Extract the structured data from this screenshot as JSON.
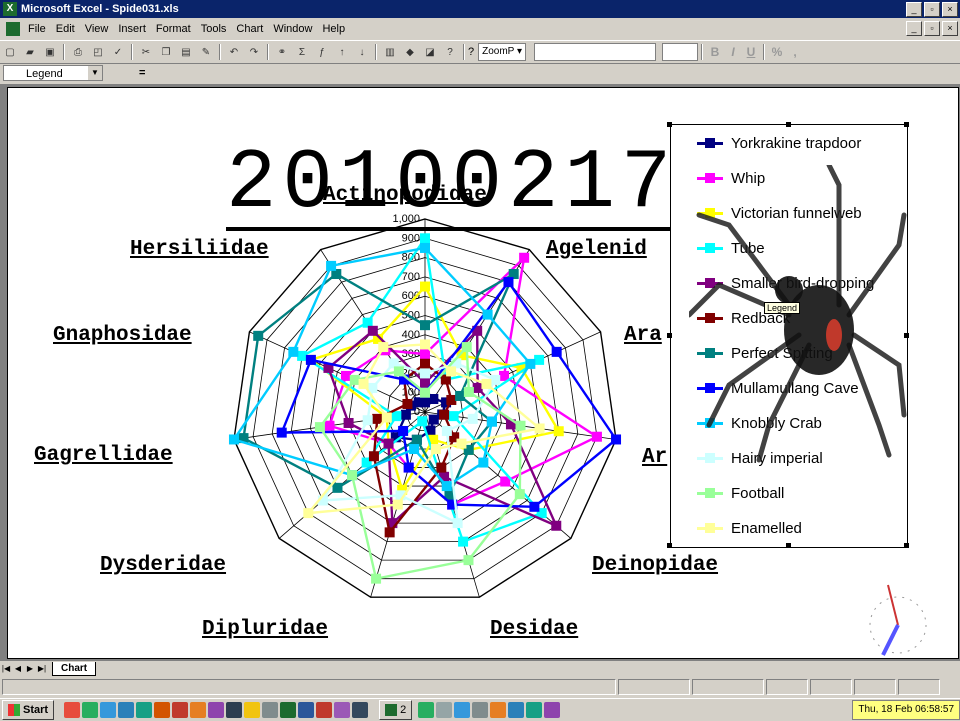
{
  "window": {
    "title": "Microsoft Excel - Spide031.xls",
    "min": "_",
    "max": "▫",
    "close": "×"
  },
  "menu": [
    "File",
    "Edit",
    "View",
    "Insert",
    "Format",
    "Tools",
    "Chart",
    "Window",
    "Help"
  ],
  "toolbar": {
    "zoom": "ZoomP",
    "help_q": "?"
  },
  "formula_bar": {
    "name_box": "Legend",
    "eq": "="
  },
  "chart_data": {
    "type": "radar",
    "title": "20100217",
    "categories": [
      "Actinopodidae",
      "Agelenidae",
      "Araneidae",
      "Archaeidae",
      "Deinopidae",
      "Desidae",
      "Dipluridae",
      "Dysderidae",
      "Gagrellidae",
      "Gnaphosidae",
      "Hersiliidae"
    ],
    "categories_shown": [
      "Actinopodidae",
      "Agelenid",
      "Ara",
      "Ar",
      "Deinopidae",
      "Desidae",
      "Dipluridae",
      "Dysderidae",
      "Gagrellidae",
      "Gnaphosidae",
      "Hersiliidae"
    ],
    "rmax": 1000,
    "axis_ticks": [
      "1,000",
      "900",
      "800",
      "700",
      "600",
      "500",
      "400",
      "300",
      "200",
      "100",
      "0"
    ],
    "series": [
      {
        "name": "Yorkrakine trapdoor",
        "color": "#000080",
        "values": [
          50,
          80,
          120,
          90,
          60,
          100,
          150,
          200,
          100,
          80,
          60
        ]
      },
      {
        "name": "Whip",
        "color": "#ff00ff",
        "values": [
          300,
          950,
          450,
          900,
          550,
          500,
          300,
          250,
          500,
          450,
          380
        ]
      },
      {
        "name": "Victorian funnelweb",
        "color": "#ffff00",
        "values": [
          650,
          350,
          550,
          700,
          300,
          150,
          420,
          250,
          200,
          650,
          450
        ]
      },
      {
        "name": "Tube",
        "color": "#00ffff",
        "values": [
          900,
          200,
          650,
          150,
          800,
          700,
          50,
          400,
          150,
          700,
          550
        ]
      },
      {
        "name": "Smaller bird-dropping",
        "color": "#800080",
        "values": [
          150,
          500,
          300,
          450,
          900,
          350,
          600,
          250,
          400,
          550,
          500
        ]
      },
      {
        "name": "Redback",
        "color": "#800000",
        "values": [
          250,
          200,
          150,
          100,
          200,
          300,
          650,
          350,
          250,
          100,
          200
        ]
      },
      {
        "name": "Perfect Spitting",
        "color": "#008080",
        "values": [
          450,
          850,
          200,
          350,
          300,
          450,
          150,
          600,
          950,
          950,
          850
        ]
      },
      {
        "name": "Mullamullang Cave",
        "color": "#0000ff",
        "values": [
          100,
          800,
          750,
          1000,
          750,
          500,
          300,
          150,
          750,
          650,
          200
        ]
      },
      {
        "name": "Knobbly Crab",
        "color": "#00ccff",
        "values": [
          850,
          600,
          600,
          350,
          400,
          400,
          200,
          500,
          1000,
          750,
          900
        ]
      },
      {
        "name": "Hairy imperial",
        "color": "#ccffff",
        "values": [
          200,
          300,
          400,
          250,
          150,
          600,
          450,
          700,
          300,
          300,
          300
        ]
      },
      {
        "name": "Football",
        "color": "#99ff99",
        "values": [
          100,
          400,
          250,
          500,
          650,
          800,
          900,
          500,
          550,
          400,
          250
        ]
      },
      {
        "name": "Enamelled",
        "color": "#ffff99",
        "values": [
          350,
          250,
          350,
          600,
          250,
          200,
          500,
          800,
          200,
          350,
          400
        ]
      }
    ]
  },
  "legend_tooltip": "Legend",
  "sheet_tab": "Chart",
  "taskbar": {
    "start": "Start",
    "task_label": "2",
    "clock": "Thu, 18 Feb 06:58:57"
  }
}
